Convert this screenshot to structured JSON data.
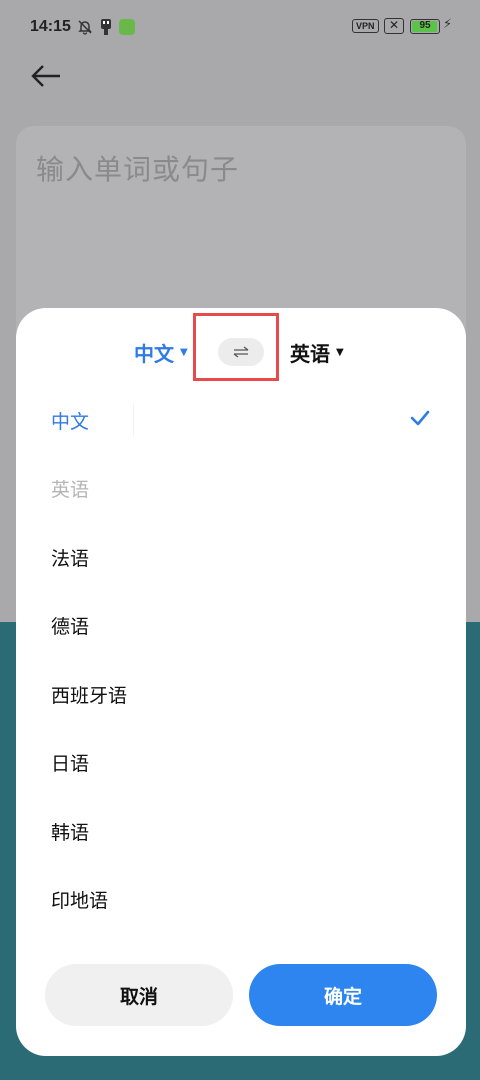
{
  "status_bar": {
    "time": "14:15",
    "vpn": "VPN",
    "sim": "✕",
    "battery_level": "95",
    "battery_fraction": 0.95
  },
  "input": {
    "placeholder": "输入单词或句子"
  },
  "sheet": {
    "source_language": "中文",
    "target_language": "英语",
    "languages": [
      {
        "label": "中文",
        "state": "selected"
      },
      {
        "label": "英语",
        "state": "disabled"
      },
      {
        "label": "法语",
        "state": "normal"
      },
      {
        "label": "德语",
        "state": "normal"
      },
      {
        "label": "西班牙语",
        "state": "normal"
      },
      {
        "label": "日语",
        "state": "normal"
      },
      {
        "label": "韩语",
        "state": "normal"
      },
      {
        "label": "印地语",
        "state": "normal"
      }
    ],
    "cancel_label": "取消",
    "confirm_label": "确定"
  },
  "colors": {
    "accent": "#2e7be6",
    "confirm": "#2e85ef",
    "highlight": "#e84a4a",
    "backdrop": "#a9a9ab",
    "teal": "#2a6b75"
  },
  "icons": {
    "back": "arrow-left-icon",
    "swap": "swap-arrows-icon",
    "check": "check-icon"
  }
}
